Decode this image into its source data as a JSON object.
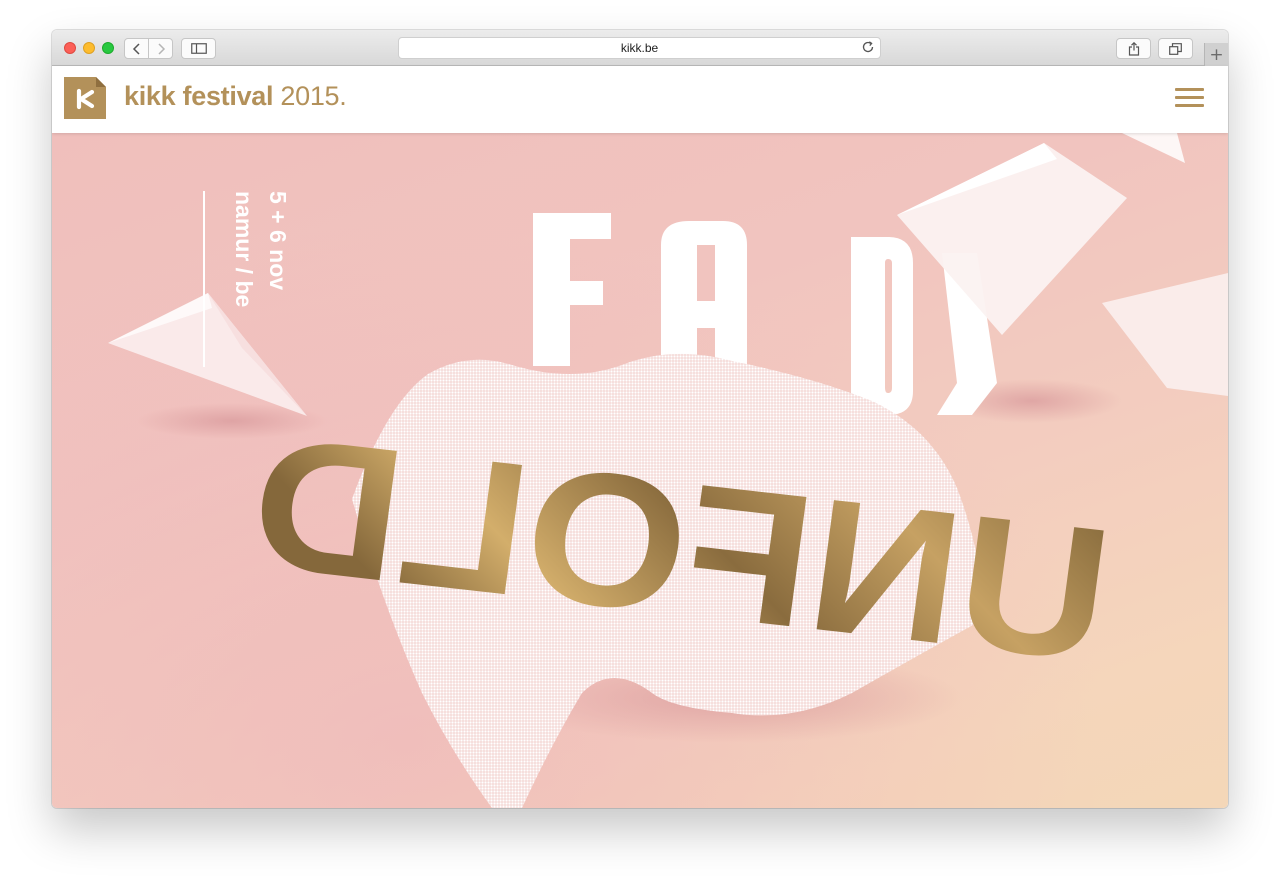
{
  "browser": {
    "url": "kikk.be",
    "icons": {
      "back": "chevron-left-icon",
      "forward": "chevron-right-icon",
      "sidebar": "sidebar-icon",
      "reload": "reload-icon",
      "share": "share-icon",
      "tabs": "tabs-icon",
      "new_tab": "plus-icon"
    },
    "new_tab_glyph": "+"
  },
  "site": {
    "brand_name": "kikk festival",
    "brand_year": "2015.",
    "accent_color": "#b3915a",
    "menu_icon": "hamburger-icon"
  },
  "hero": {
    "date_line1": "5 + 6 nov",
    "date_line2": "namur / be",
    "artwork_text": "UNFOLD",
    "background_color": "#f1c3bf"
  }
}
